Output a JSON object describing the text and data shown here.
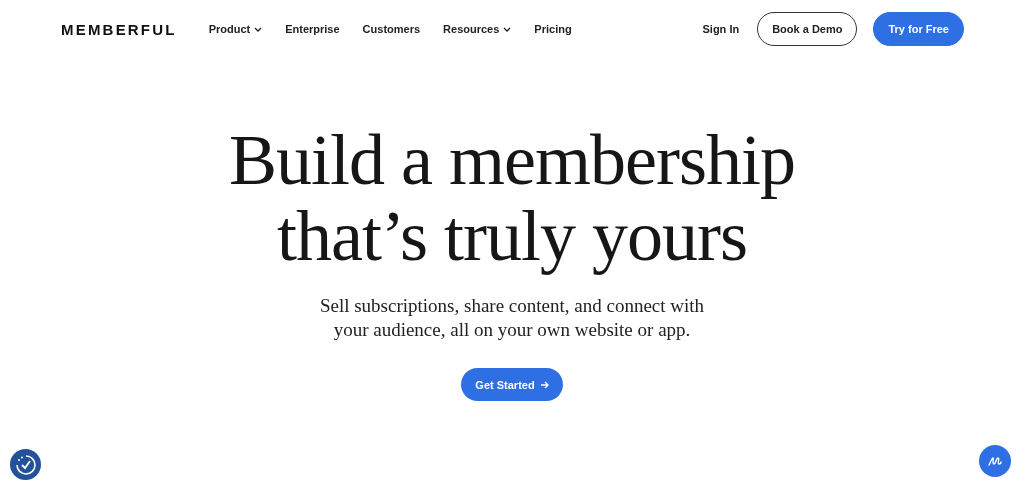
{
  "brand": {
    "logo": "MEMBERFUL"
  },
  "nav": {
    "items": [
      {
        "label": "Product",
        "kind": "dropdown"
      },
      {
        "label": "Enterprise",
        "kind": "link"
      },
      {
        "label": "Customers",
        "kind": "link"
      },
      {
        "label": "Resources",
        "kind": "dropdown"
      },
      {
        "label": "Pricing",
        "kind": "link"
      }
    ],
    "actions": [
      {
        "label": "Sign In",
        "kind": "link"
      },
      {
        "label": "Book a Demo",
        "kind": "outline"
      },
      {
        "label": "Try for Free",
        "kind": "primary"
      }
    ]
  },
  "hero": {
    "title": [
      "Build a membership",
      "that’s truly yours"
    ],
    "subtitle": [
      "Sell subscriptions, share content, and connect with",
      "your audience, all on your own website or app."
    ],
    "cta": "Get Started"
  }
}
